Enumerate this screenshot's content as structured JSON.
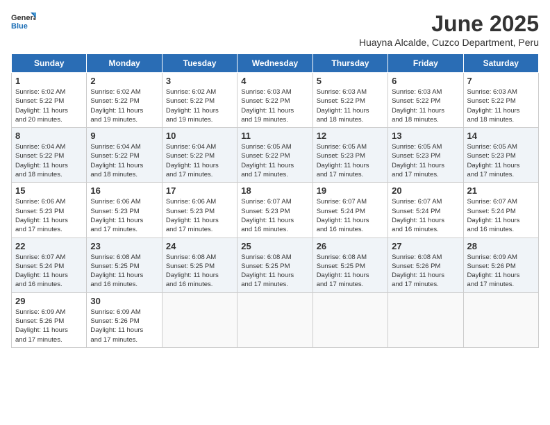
{
  "header": {
    "logo_line1": "General",
    "logo_line2": "Blue",
    "title": "June 2025",
    "subtitle": "Huayna Alcalde, Cuzco Department, Peru"
  },
  "calendar": {
    "headers": [
      "Sunday",
      "Monday",
      "Tuesday",
      "Wednesday",
      "Thursday",
      "Friday",
      "Saturday"
    ],
    "weeks": [
      [
        {
          "day": "1",
          "detail": "Sunrise: 6:02 AM\nSunset: 5:22 PM\nDaylight: 11 hours\nand 20 minutes."
        },
        {
          "day": "2",
          "detail": "Sunrise: 6:02 AM\nSunset: 5:22 PM\nDaylight: 11 hours\nand 19 minutes."
        },
        {
          "day": "3",
          "detail": "Sunrise: 6:02 AM\nSunset: 5:22 PM\nDaylight: 11 hours\nand 19 minutes."
        },
        {
          "day": "4",
          "detail": "Sunrise: 6:03 AM\nSunset: 5:22 PM\nDaylight: 11 hours\nand 19 minutes."
        },
        {
          "day": "5",
          "detail": "Sunrise: 6:03 AM\nSunset: 5:22 PM\nDaylight: 11 hours\nand 18 minutes."
        },
        {
          "day": "6",
          "detail": "Sunrise: 6:03 AM\nSunset: 5:22 PM\nDaylight: 11 hours\nand 18 minutes."
        },
        {
          "day": "7",
          "detail": "Sunrise: 6:03 AM\nSunset: 5:22 PM\nDaylight: 11 hours\nand 18 minutes."
        }
      ],
      [
        {
          "day": "8",
          "detail": "Sunrise: 6:04 AM\nSunset: 5:22 PM\nDaylight: 11 hours\nand 18 minutes."
        },
        {
          "day": "9",
          "detail": "Sunrise: 6:04 AM\nSunset: 5:22 PM\nDaylight: 11 hours\nand 18 minutes."
        },
        {
          "day": "10",
          "detail": "Sunrise: 6:04 AM\nSunset: 5:22 PM\nDaylight: 11 hours\nand 17 minutes."
        },
        {
          "day": "11",
          "detail": "Sunrise: 6:05 AM\nSunset: 5:22 PM\nDaylight: 11 hours\nand 17 minutes."
        },
        {
          "day": "12",
          "detail": "Sunrise: 6:05 AM\nSunset: 5:23 PM\nDaylight: 11 hours\nand 17 minutes."
        },
        {
          "day": "13",
          "detail": "Sunrise: 6:05 AM\nSunset: 5:23 PM\nDaylight: 11 hours\nand 17 minutes."
        },
        {
          "day": "14",
          "detail": "Sunrise: 6:05 AM\nSunset: 5:23 PM\nDaylight: 11 hours\nand 17 minutes."
        }
      ],
      [
        {
          "day": "15",
          "detail": "Sunrise: 6:06 AM\nSunset: 5:23 PM\nDaylight: 11 hours\nand 17 minutes."
        },
        {
          "day": "16",
          "detail": "Sunrise: 6:06 AM\nSunset: 5:23 PM\nDaylight: 11 hours\nand 17 minutes."
        },
        {
          "day": "17",
          "detail": "Sunrise: 6:06 AM\nSunset: 5:23 PM\nDaylight: 11 hours\nand 17 minutes."
        },
        {
          "day": "18",
          "detail": "Sunrise: 6:07 AM\nSunset: 5:23 PM\nDaylight: 11 hours\nand 16 minutes."
        },
        {
          "day": "19",
          "detail": "Sunrise: 6:07 AM\nSunset: 5:24 PM\nDaylight: 11 hours\nand 16 minutes."
        },
        {
          "day": "20",
          "detail": "Sunrise: 6:07 AM\nSunset: 5:24 PM\nDaylight: 11 hours\nand 16 minutes."
        },
        {
          "day": "21",
          "detail": "Sunrise: 6:07 AM\nSunset: 5:24 PM\nDaylight: 11 hours\nand 16 minutes."
        }
      ],
      [
        {
          "day": "22",
          "detail": "Sunrise: 6:07 AM\nSunset: 5:24 PM\nDaylight: 11 hours\nand 16 minutes."
        },
        {
          "day": "23",
          "detail": "Sunrise: 6:08 AM\nSunset: 5:25 PM\nDaylight: 11 hours\nand 16 minutes."
        },
        {
          "day": "24",
          "detail": "Sunrise: 6:08 AM\nSunset: 5:25 PM\nDaylight: 11 hours\nand 16 minutes."
        },
        {
          "day": "25",
          "detail": "Sunrise: 6:08 AM\nSunset: 5:25 PM\nDaylight: 11 hours\nand 17 minutes."
        },
        {
          "day": "26",
          "detail": "Sunrise: 6:08 AM\nSunset: 5:25 PM\nDaylight: 11 hours\nand 17 minutes."
        },
        {
          "day": "27",
          "detail": "Sunrise: 6:08 AM\nSunset: 5:26 PM\nDaylight: 11 hours\nand 17 minutes."
        },
        {
          "day": "28",
          "detail": "Sunrise: 6:09 AM\nSunset: 5:26 PM\nDaylight: 11 hours\nand 17 minutes."
        }
      ],
      [
        {
          "day": "29",
          "detail": "Sunrise: 6:09 AM\nSunset: 5:26 PM\nDaylight: 11 hours\nand 17 minutes."
        },
        {
          "day": "30",
          "detail": "Sunrise: 6:09 AM\nSunset: 5:26 PM\nDaylight: 11 hours\nand 17 minutes."
        },
        {
          "day": "",
          "detail": ""
        },
        {
          "day": "",
          "detail": ""
        },
        {
          "day": "",
          "detail": ""
        },
        {
          "day": "",
          "detail": ""
        },
        {
          "day": "",
          "detail": ""
        }
      ]
    ]
  }
}
